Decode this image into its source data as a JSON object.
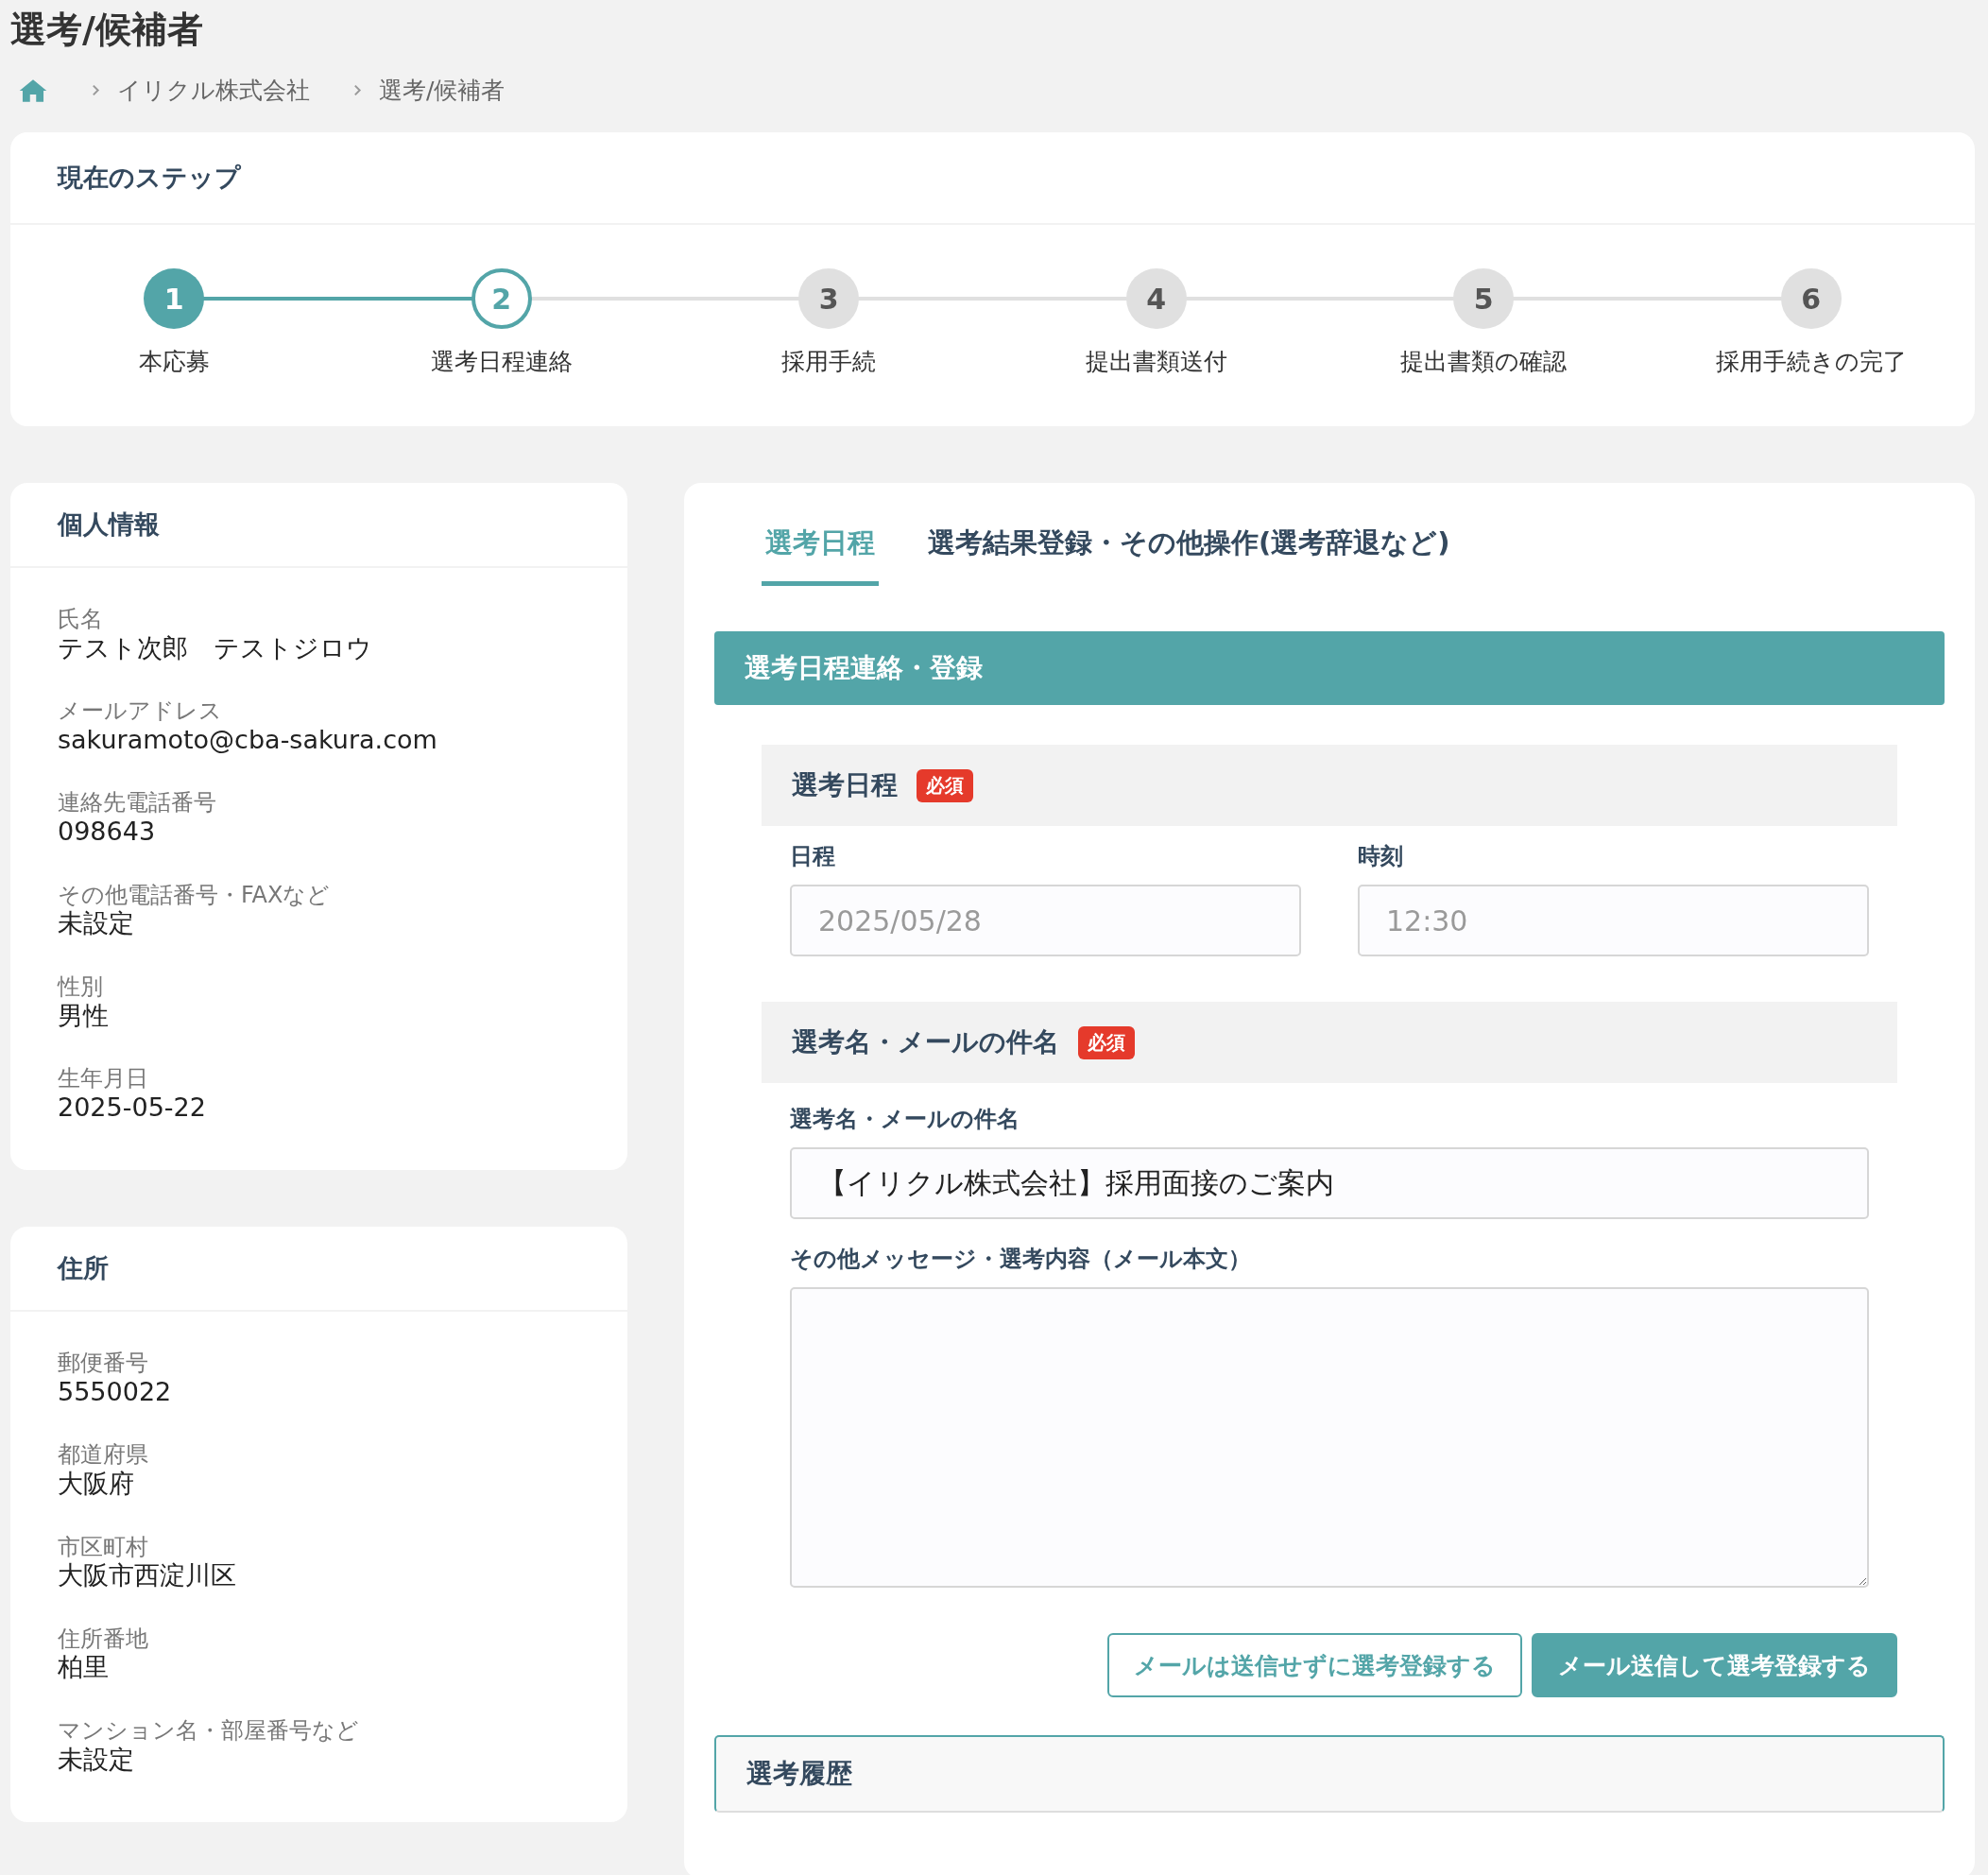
{
  "page_title": "選考/候補者",
  "breadcrumb": [
    "イリクル株式会社",
    "選考/候補者"
  ],
  "steps_card": {
    "title": "現在のステップ",
    "steps": [
      {
        "number": "1",
        "label": "本応募",
        "done": true,
        "selected": false
      },
      {
        "number": "2",
        "label": "選考日程連絡",
        "done": false,
        "selected": true
      },
      {
        "number": "3",
        "label": "採用手続",
        "done": false,
        "selected": false
      },
      {
        "number": "4",
        "label": "提出書類送付",
        "done": false,
        "selected": false
      },
      {
        "number": "5",
        "label": "提出書類の確認",
        "done": false,
        "selected": false
      },
      {
        "number": "6",
        "label": "採用手続きの完了",
        "done": false,
        "selected": false
      }
    ]
  },
  "personal_info": {
    "title": "個人情報",
    "fields": [
      {
        "label": "氏名",
        "value": "テスト次郎　テストジロウ"
      },
      {
        "label": "メールアドレス",
        "value": "sakuramoto@cba-sakura.com"
      },
      {
        "label": "連絡先電話番号",
        "value": "098643"
      },
      {
        "label": "その他電話番号・FAXなど",
        "value": "未設定"
      },
      {
        "label": "性別",
        "value": "男性"
      },
      {
        "label": "生年月日",
        "value": "2025-05-22"
      }
    ]
  },
  "address": {
    "title": "住所",
    "fields": [
      {
        "label": "郵便番号",
        "value": "5550022"
      },
      {
        "label": "都道府県",
        "value": "大阪府"
      },
      {
        "label": "市区町村",
        "value": "大阪市西淀川区"
      },
      {
        "label": "住所番地",
        "value": "柏里"
      },
      {
        "label": "マンション名・部屋番号など",
        "value": "未設定"
      }
    ]
  },
  "tabs": [
    {
      "label": "選考日程",
      "selected": true
    },
    {
      "label": "選考結果登録・その他操作(選考辞退など)",
      "selected": false
    }
  ],
  "schedule_form": {
    "title": "選考日程連絡・登録",
    "schedule_section": {
      "title": "選考日程",
      "required_badge": "必須",
      "date_label": "日程",
      "date_value": "2025/05/28",
      "time_label": "時刻",
      "time_value": "12:30"
    },
    "subject_section": {
      "title": "選考名・メールの件名",
      "required_badge": "必須",
      "subject_label": "選考名・メールの件名",
      "subject_value": "【イリクル株式会社】採用面接のご案内",
      "message_label": "その他メッセージ・選考内容（メール本文）"
    },
    "buttons": [
      {
        "label": "メールは送信せずに選考登録する",
        "kind": "outline"
      },
      {
        "label": "メール送信して選考登録する",
        "kind": "primary"
      }
    ]
  },
  "history": {
    "title": "選考履歴"
  }
}
